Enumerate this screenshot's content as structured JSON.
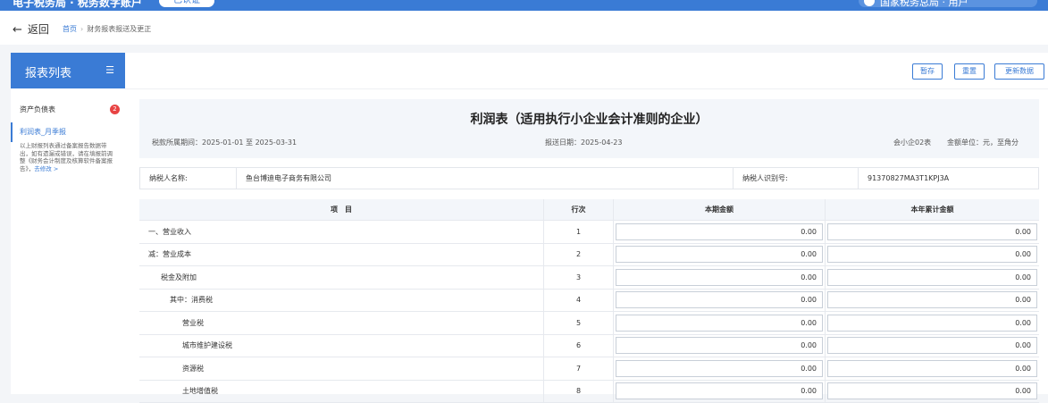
{
  "topbar": {
    "brand": "电子税务局 · 税务数字账户",
    "pill": "已认证",
    "user": "国家税务总局 · 用户"
  },
  "nav": {
    "back_label": "返回",
    "crumb_home": "首页",
    "crumb_sep": "›",
    "crumb_current": "财务报表报送及更正"
  },
  "sidebar": {
    "title": "报表列表",
    "items": [
      {
        "label": "资产负债表",
        "badge": "2"
      },
      {
        "label": "利润表_月季报"
      }
    ],
    "note": "以上财报列表通过备案报告数据带出，如有遗漏或错误，请在填报前调整《财务会计制度及核算软件备案报告》，",
    "note_link": "去修改 >"
  },
  "toolbar": {
    "save_label": "暂存",
    "reset_label": "重置",
    "update_label": "更新数据"
  },
  "report": {
    "title": "利润表（适用执行小企业会计准则的企业）",
    "period": "税款所属期间：2025-01-01 至 2025-03-31",
    "submit_date": "报送日期：2025-04-23",
    "form_code": "会小企02表",
    "unit": "金额单位：元，至角分"
  },
  "taxpayer": {
    "name_label": "纳税人名称:",
    "name_value": "鱼台博迪电子商务有限公司",
    "id_label": "纳税人识别号:",
    "id_value": "91370827MA3T1KPJ3A"
  },
  "table": {
    "headers": [
      "项　目",
      "行次",
      "本期金额",
      "本年累计金额"
    ],
    "rows": [
      {
        "item": "一、营业收入",
        "line": "1",
        "current": "0.00",
        "ytd": "0.00"
      },
      {
        "item": "减：营业成本",
        "line": "2",
        "current": "0.00",
        "ytd": "0.00"
      },
      {
        "item": "税金及附加",
        "line": "3",
        "current": "0.00",
        "ytd": "0.00"
      },
      {
        "item": "其中：消费税",
        "line": "4",
        "current": "0.00",
        "ytd": "0.00"
      },
      {
        "item": "营业税",
        "line": "5",
        "current": "0.00",
        "ytd": "0.00"
      },
      {
        "item": "城市维护建设税",
        "line": "6",
        "current": "0.00",
        "ytd": "0.00"
      },
      {
        "item": "资源税",
        "line": "7",
        "current": "0.00",
        "ytd": "0.00"
      },
      {
        "item": "土地增值税",
        "line": "8",
        "current": "0.00",
        "ytd": "0.00"
      }
    ]
  }
}
